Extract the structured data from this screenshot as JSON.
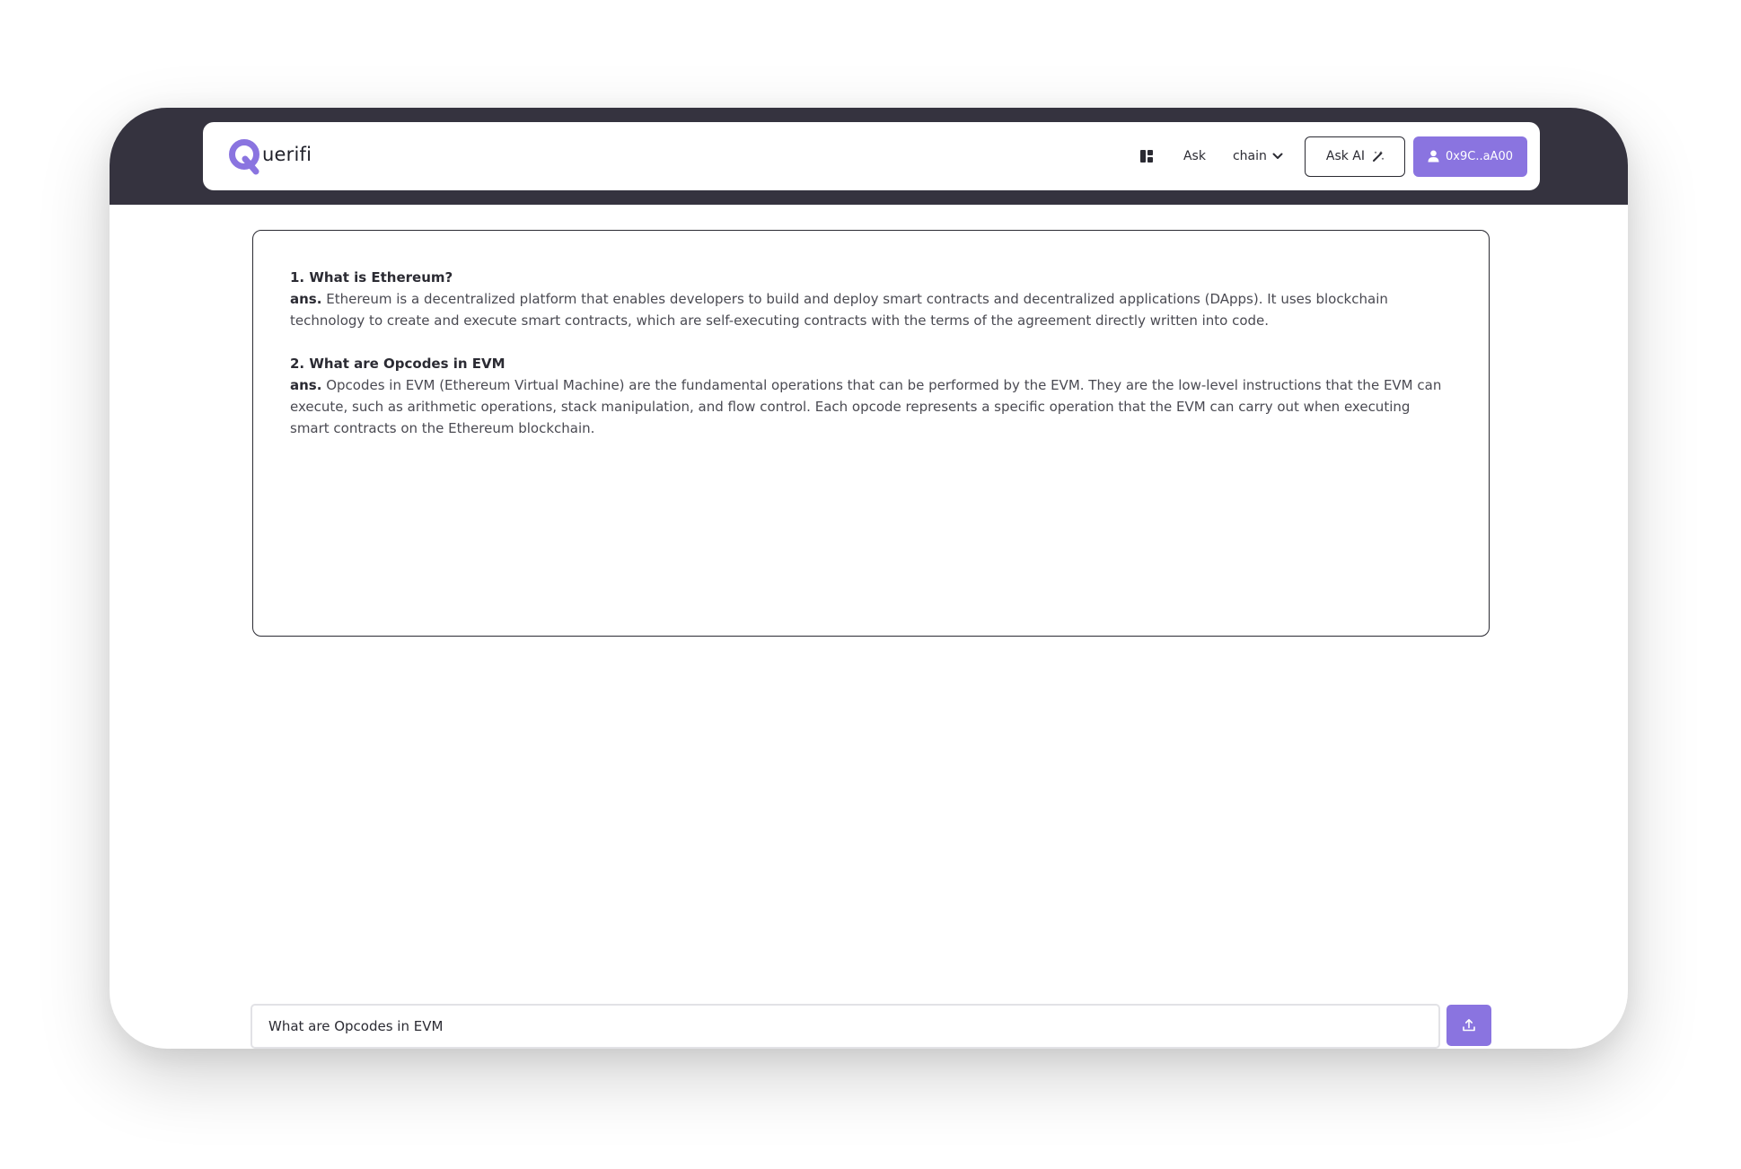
{
  "app": {
    "logo_text": "uerifi",
    "logo_letter": "Q"
  },
  "nav": {
    "dashboard_icon": "dashboard-icon",
    "ask_label": "Ask",
    "chain_label": "chain",
    "ask_ai_label": "Ask AI",
    "wallet_label": "0x9C..aA00"
  },
  "answers": [
    {
      "question": "1. What is Ethereum?",
      "ans_label": "ans.",
      "answer": "Ethereum is a decentralized platform that enables developers to build and deploy smart contracts and decentralized applications (DApps). It uses blockchain technology to create and execute smart contracts, which are self-executing contracts with the terms of the agreement directly written into code."
    },
    {
      "question": "2. What are Opcodes in EVM",
      "ans_label": "ans.",
      "answer": "Opcodes in EVM (Ethereum Virtual Machine) are the fundamental operations that can be performed by the EVM. They are the low-level instructions that the EVM can execute, such as arithmetic operations, stack manipulation, and flow control. Each opcode represents a specific operation that the EVM can carry out when executing smart contracts on the Ethereum blockchain."
    }
  ],
  "query": {
    "value": "What are Opcodes in EVM"
  },
  "colors": {
    "accent": "#8a74e0",
    "header_band": "#35333f",
    "text_dark": "#2b2b33"
  }
}
